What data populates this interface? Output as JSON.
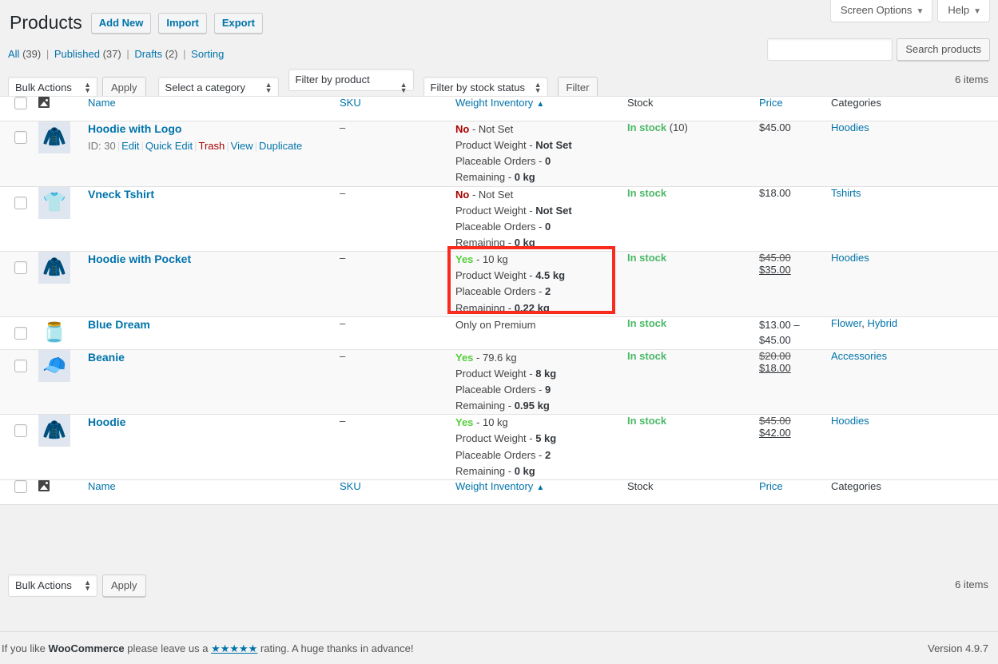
{
  "screen_meta": {
    "screen_options_label": "Screen Options",
    "help_label": "Help",
    "caret": "▼"
  },
  "header": {
    "title": "Products",
    "actions": [
      {
        "label": "Add New",
        "name": "add-new-button"
      },
      {
        "label": "Import",
        "name": "import-button"
      },
      {
        "label": "Export",
        "name": "export-button"
      }
    ]
  },
  "views": {
    "all_label": "All",
    "all_count": "(39)",
    "published_label": "Published",
    "published_count": "(37)",
    "drafts_label": "Drafts",
    "drafts_count": "(2)",
    "sorting_label": "Sorting",
    "separator": "|"
  },
  "search": {
    "value": "",
    "placeholder": "",
    "button_label": "Search products"
  },
  "toolbar_top": {
    "bulk_actions_label": "Bulk Actions",
    "apply_label": "Apply",
    "category_label": "Select a category",
    "product_type_label": "Filter by product type",
    "stock_status_label": "Filter by stock status",
    "filter_label": "Filter",
    "items_count": "6 items"
  },
  "toolbar_bottom": {
    "bulk_actions_label": "Bulk Actions",
    "apply_label": "Apply",
    "items_count": "6 items"
  },
  "table": {
    "columns": {
      "name": "Name",
      "sku": "SKU",
      "weight_inventory": "Weight Inventory",
      "sort_indicator": "▲",
      "stock": "Stock",
      "price": "Price",
      "categories": "Categories"
    },
    "rows": [
      {
        "title": "Hoodie with Logo",
        "thumb": "hoodie-logo-thumb",
        "thumb_glyph": "🧥",
        "id_label": "ID: 30",
        "actions": [
          {
            "label": "Edit",
            "kind": "link"
          },
          {
            "label": "Quick Edit",
            "kind": "link"
          },
          {
            "label": "Trash",
            "kind": "trash"
          },
          {
            "label": "View",
            "kind": "link"
          },
          {
            "label": "Duplicate",
            "kind": "link"
          }
        ],
        "sku": "–",
        "weight_flag": "No",
        "weight_flag_state": "no",
        "weight_flag_value": "- Not Set",
        "product_weight_label": "Product Weight -",
        "product_weight_value": "Not Set",
        "placeable_orders_label": "Placeable Orders -",
        "placeable_orders_value": "0",
        "remaining_label": "Remaining -",
        "remaining_value": "0 kg",
        "stock_status": "In stock",
        "stock_count": "(10)",
        "price_regular": "$45.00",
        "price_sale": "",
        "price_range": "",
        "categories": [
          "Hoodies"
        ]
      },
      {
        "title": "Vneck Tshirt",
        "thumb": "vneck-tshirt-thumb",
        "thumb_glyph": "👕",
        "id_label": "",
        "actions": [],
        "sku": "–",
        "weight_flag": "No",
        "weight_flag_state": "no",
        "weight_flag_value": "- Not Set",
        "product_weight_label": "Product Weight -",
        "product_weight_value": "Not Set",
        "placeable_orders_label": "Placeable Orders -",
        "placeable_orders_value": "0",
        "remaining_label": "Remaining -",
        "remaining_value": "0 kg",
        "stock_status": "In stock",
        "stock_count": "",
        "price_regular": "$18.00",
        "price_sale": "",
        "price_range": "",
        "categories": [
          "Tshirts"
        ]
      },
      {
        "title": "Hoodie with Pocket",
        "thumb": "hoodie-pocket-thumb",
        "thumb_glyph": "🧥",
        "id_label": "",
        "actions": [],
        "sku": "–",
        "weight_flag": "Yes",
        "weight_flag_state": "yes",
        "weight_flag_value": "- 10 kg",
        "product_weight_label": "Product Weight -",
        "product_weight_value": "4.5 kg",
        "placeable_orders_label": "Placeable Orders -",
        "placeable_orders_value": "2",
        "remaining_label": "Remaining -",
        "remaining_value": "0.22 kg",
        "stock_status": "In stock",
        "stock_count": "",
        "price_regular": "$45.00",
        "price_sale": "$35.00",
        "price_range": "",
        "categories": [
          "Hoodies"
        ]
      },
      {
        "title": "Blue Dream",
        "thumb": "blue-dream-thumb",
        "thumb_glyph": "🫙",
        "id_label": "",
        "actions": [],
        "sku": "–",
        "weight_flag": "",
        "weight_flag_state": "premium",
        "weight_flag_value": "Only on Premium",
        "product_weight_label": "",
        "product_weight_value": "",
        "placeable_orders_label": "",
        "placeable_orders_value": "",
        "remaining_label": "",
        "remaining_value": "",
        "stock_status": "In stock",
        "stock_count": "",
        "price_regular": "",
        "price_sale": "",
        "price_range": "$13.00 – $45.00",
        "categories": [
          "Flower",
          "Hybrid"
        ]
      },
      {
        "title": "Beanie",
        "thumb": "beanie-thumb",
        "thumb_glyph": "🧢",
        "id_label": "",
        "actions": [],
        "sku": "–",
        "weight_flag": "Yes",
        "weight_flag_state": "yes",
        "weight_flag_value": "- 79.6 kg",
        "product_weight_label": "Product Weight -",
        "product_weight_value": "8 kg",
        "placeable_orders_label": "Placeable Orders -",
        "placeable_orders_value": "9",
        "remaining_label": "Remaining -",
        "remaining_value": "0.95 kg",
        "stock_status": "In stock",
        "stock_count": "",
        "price_regular": "$20.00",
        "price_sale": "$18.00",
        "price_range": "",
        "categories": [
          "Accessories"
        ]
      },
      {
        "title": "Hoodie",
        "thumb": "hoodie-thumb",
        "thumb_glyph": "🧥",
        "id_label": "",
        "actions": [],
        "sku": "–",
        "weight_flag": "Yes",
        "weight_flag_state": "yes",
        "weight_flag_value": "- 10 kg",
        "product_weight_label": "Product Weight -",
        "product_weight_value": "5 kg",
        "placeable_orders_label": "Placeable Orders -",
        "placeable_orders_value": "2",
        "remaining_label": "Remaining -",
        "remaining_value": "0 kg",
        "stock_status": "In stock",
        "stock_count": "",
        "price_regular": "$45.00",
        "price_sale": "$42.00",
        "price_range": "",
        "categories": [
          "Hoodies"
        ]
      }
    ]
  },
  "highlight": {
    "color": "#f72c1f",
    "target": "weight-inventory-cell-hoodie-with-pocket"
  },
  "footer": {
    "text_before": "If you like ",
    "brand": "WooCommerce",
    "text_middle": " please leave us a ",
    "stars": "★★★★★",
    "text_after": " rating. A huge thanks in advance!",
    "version": "Version 4.9.7"
  }
}
